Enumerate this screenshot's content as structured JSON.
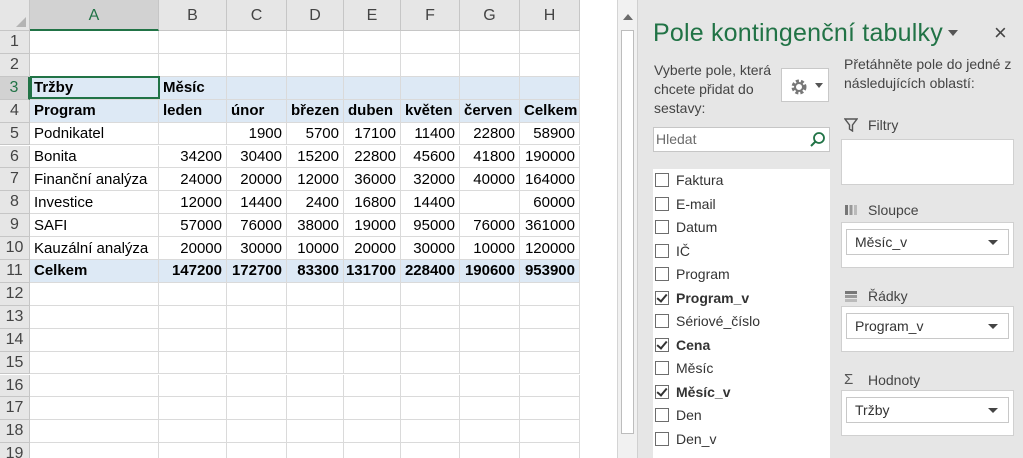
{
  "sheet": {
    "columns": [
      "A",
      "B",
      "C",
      "D",
      "E",
      "F",
      "G",
      "H"
    ],
    "rows": [
      "1",
      "2",
      "3",
      "4",
      "5",
      "6",
      "7",
      "8",
      "9",
      "10",
      "11",
      "12",
      "13",
      "14",
      "15",
      "16",
      "17",
      "18",
      "19"
    ],
    "pivot": {
      "values_label": "Tržby",
      "columns_label": "Měsíc",
      "rows_label": "Program",
      "months": [
        "leden",
        "únor",
        "březen",
        "duben",
        "květen",
        "červen",
        "Celkem"
      ],
      "data_rows": [
        {
          "program": "Podnikatel",
          "values": [
            "",
            "1900",
            "5700",
            "17100",
            "11400",
            "22800",
            "58900"
          ]
        },
        {
          "program": "Bonita",
          "values": [
            "34200",
            "30400",
            "15200",
            "22800",
            "45600",
            "41800",
            "190000"
          ]
        },
        {
          "program": "Finanční analýza",
          "values": [
            "24000",
            "20000",
            "12000",
            "36000",
            "32000",
            "40000",
            "164000"
          ]
        },
        {
          "program": "Investice",
          "values": [
            "12000",
            "14400",
            "2400",
            "16800",
            "14400",
            "",
            "60000"
          ]
        },
        {
          "program": "SAFI",
          "values": [
            "57000",
            "76000",
            "38000",
            "19000",
            "95000",
            "76000",
            "361000"
          ]
        },
        {
          "program": "Kauzální analýza",
          "values": [
            "20000",
            "30000",
            "10000",
            "20000",
            "30000",
            "10000",
            "120000"
          ]
        }
      ],
      "total_row": {
        "program": "Celkem",
        "values": [
          "147200",
          "172700",
          "83300",
          "131700",
          "228400",
          "190600",
          "953900"
        ]
      }
    }
  },
  "pane": {
    "title": "Pole kontingenční tabulky",
    "close": "×",
    "choose_text": "Vyberte pole, která chcete přidat do sestavy:",
    "search_placeholder": "Hledat",
    "fields": [
      {
        "label": "Faktura",
        "checked": false
      },
      {
        "label": "E-mail",
        "checked": false
      },
      {
        "label": "Datum",
        "checked": false
      },
      {
        "label": "IČ",
        "checked": false
      },
      {
        "label": "Program",
        "checked": false
      },
      {
        "label": "Program_v",
        "checked": true
      },
      {
        "label": "Sériové_číslo",
        "checked": false
      },
      {
        "label": "Cena",
        "checked": true
      },
      {
        "label": "Měsíc",
        "checked": false
      },
      {
        "label": "Měsíc_v",
        "checked": true
      },
      {
        "label": "Den",
        "checked": false
      },
      {
        "label": "Den_v",
        "checked": false
      }
    ],
    "drag_text": "Přetáhněte pole do jedné z následujících oblastí:",
    "areas": {
      "filters": {
        "label": "Filtry",
        "icon": "filter-icon"
      },
      "columns": {
        "label": "Sloupce",
        "icon": "columns-icon",
        "item": "Měsíc_v"
      },
      "rows": {
        "label": "Řádky",
        "icon": "rows-icon",
        "item": "Program_v"
      },
      "values": {
        "label": "Hodnoty",
        "icon": "sigma-icon",
        "item": "Tržby"
      }
    }
  }
}
